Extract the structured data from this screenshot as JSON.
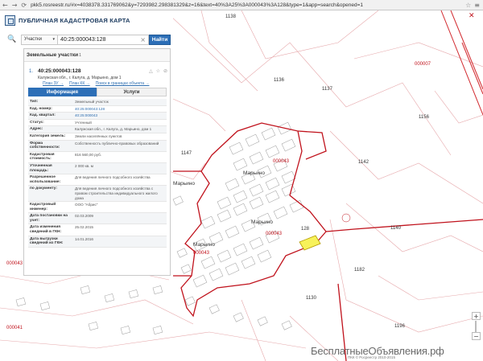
{
  "browser": {
    "back_icon": "back-arrow-icon",
    "forward_icon": "forward-arrow-icon",
    "reload_icon": "reload-icon",
    "url": "pkk5.rosreestr.ru/#x=4038378.331769062&y=7293982.298381329&z=16&text=40%3A25%3A000043%3A128&type=1&app=search&opened=1"
  },
  "header": {
    "title": "ПУБЛИЧНАЯ КАДАСТРОВАЯ КАРТА"
  },
  "search": {
    "type_label": "Участки",
    "query": "40:25:000043:128",
    "button": "Найти"
  },
  "panel": {
    "section_label": "Земельные участки",
    "section_count": "1",
    "result": {
      "index": "1.",
      "code": "40:25:000043:128",
      "address": "Калужская обл., г. Калуга, д. Марьино, дом 1",
      "links": [
        "План ЗУ →",
        "План КК →",
        "Поиск в границах объекта →"
      ]
    },
    "tabs": [
      "Информация",
      "Услуги"
    ],
    "info_rows": [
      {
        "k": "Тип:",
        "v": "Земельный участок",
        "link": false
      },
      {
        "k": "Кад. номер:",
        "v": "40:25:000043:128",
        "link": true
      },
      {
        "k": "Кад. квартал:",
        "v": "40:25:000043",
        "link": true
      },
      {
        "k": "Статус:",
        "v": "Учтенный",
        "link": false
      },
      {
        "k": "Адрес:",
        "v": "Калужская обл., г. Калуга, д. Марьино, дом 1",
        "link": false
      },
      {
        "k": "Категория земель:",
        "v": "Земли населённых пунктов",
        "link": false
      },
      {
        "k": "Форма собственности:",
        "v": "Собственность публично-правовых образований",
        "link": false
      },
      {
        "k": "Кадастровая стоимость:",
        "v": "816 560,00 руб.",
        "link": false
      },
      {
        "k": "Уточненная площадь:",
        "v": "2 000 кв. м",
        "link": false
      },
      {
        "k": "Разрешенное использование:",
        "v": "Для ведения личного подсобного хозяйства",
        "link": false
      },
      {
        "k": "по документу:",
        "v": "Для ведения личного подсобного хозяйства с правом строительства индивидуального жилого дома",
        "link": false
      },
      {
        "k": "Кадастровый инженер:",
        "v": "ООО \"Абрис\"",
        "link": false
      },
      {
        "k": "Дата постановки на учет:",
        "v": "02.03.2009",
        "link": false
      },
      {
        "k": "Дата изменения сведений в ГКН:",
        "v": "25.02.2015",
        "link": false
      },
      {
        "k": "Дата выгрузки сведений из ГКН:",
        "v": "14.01.2016",
        "link": false
      }
    ]
  },
  "map": {
    "labels": [
      {
        "text": "000043",
        "cls": "red"
      },
      {
        "text": "Марьино",
        "cls": "big"
      },
      {
        "text": "Марьино",
        "cls": "big"
      },
      {
        "text": "Марьино",
        "cls": "big"
      },
      {
        "text": "Марьино",
        "cls": "big"
      },
      {
        "text": "000043",
        "cls": "red"
      },
      {
        "text": "000043",
        "cls": "red"
      },
      {
        "text": "000007",
        "cls": "red"
      },
      {
        "text": "1138",
        "cls": ""
      },
      {
        "text": "1142",
        "cls": ""
      },
      {
        "text": "1140",
        "cls": ""
      },
      {
        "text": "1136",
        "cls": ""
      },
      {
        "text": "128",
        "cls": ""
      },
      {
        "text": "1137",
        "cls": ""
      },
      {
        "text": "1182",
        "cls": ""
      },
      {
        "text": "1156",
        "cls": ""
      },
      {
        "text": "1196",
        "cls": ""
      },
      {
        "text": "1130",
        "cls": ""
      },
      {
        "text": "1147",
        "cls": ""
      },
      {
        "text": "000041",
        "cls": "red"
      },
      {
        "text": "000043",
        "cls": "red"
      }
    ]
  },
  "footer": {
    "watermark": "БесплатныеОбъявления.рф",
    "copyright": "ПКК © Росреестр 2010-2015"
  },
  "colors": {
    "accent": "#2d6fb7",
    "boundary": "#c0121c",
    "highlight": "#f7f25a"
  },
  "icons": {
    "logo": "building-icon",
    "search": "search-icon",
    "close": "close-icon",
    "favorite": "star-icon",
    "zoom_in": "plus-icon",
    "zoom_out": "minus-icon"
  }
}
